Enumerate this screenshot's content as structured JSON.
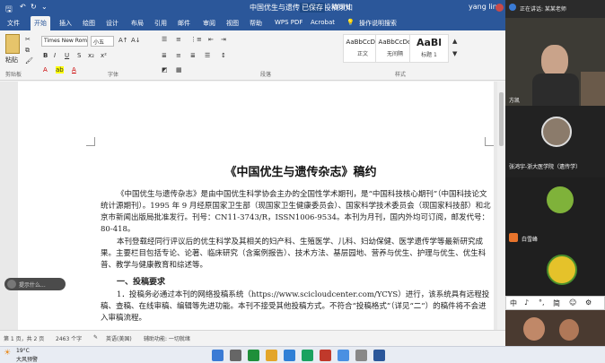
{
  "titlebar": {
    "filename": "中国优生与遗传杂志 -- 投稿须知",
    "badge": "已保存",
    "app": "Word",
    "user": "yang ling"
  },
  "tabs": [
    "文件",
    "开始",
    "插入",
    "绘图",
    "设计",
    "布局",
    "引用",
    "邮件",
    "审阅",
    "视图",
    "帮助",
    "WPS PDF",
    "Acrobat",
    "操作说明搜索"
  ],
  "ribbon": {
    "paste_label": "粘贴",
    "font_name": "Times New Roman",
    "font_size": "小五",
    "styles": [
      {
        "preview": "AaBbCcDd",
        "name": "正文"
      },
      {
        "preview": "AaBbCcDd",
        "name": "无间隔"
      },
      {
        "preview": "AaBl",
        "name": "标题 1"
      }
    ],
    "groups": [
      "剪贴板",
      "字体",
      "段落",
      "样式"
    ]
  },
  "document": {
    "title": "《中国优生与遗传杂志》稿约",
    "para1": "《中国优生与遗传杂志》是由中国优生科学协会主办的全国性学术期刊，是“中国科技核心期刊”（中国科技论文统计源期刊）。1995 年 9 月经原国家卫生部（现国家卫生健康委员会）、国家科学技术委员会（现国家科技部）和北京市新闻出版局批准发行。刊号：CN11-3743/R，ISSN1006-9534。本刊为月刊，国内外均可订阅，邮发代号：80-418。",
    "para2": "本刊登载经同行评议后的优生科学及其相关的妇产科、生殖医学、儿科、妇幼保健、医学遗传学等最新研究成果。主要栏目包括专论、论著、临床研究（含案例报告）、技术方法、基层园地、营养与优生、护理与优生、优生科普、教学与健康教育和综述等。",
    "heading1": "一、投稿要求",
    "para3": "1．投稿务必通过本刊的网络投稿系统（https://www.scicloudcenter.com/YCYS）进行，该系统具有远程投稿、查稿、在线审稿、编辑等先进功能。本刊不接受其他投稿方式。不符合“投稿格式”（详见“二”）的稿件将不会进入审稿流程。"
  },
  "bubble": {
    "text": "提示什么..."
  },
  "statusbar": {
    "page": "第 1 页，共 2 页",
    "words": "2463 个字",
    "lang": "英语(美国)",
    "a11y": "辅助功能: 一切就绪"
  },
  "taskbar": {
    "temp": "19°C",
    "weather": "大风预警"
  },
  "meeting": {
    "participants": [
      {
        "name": "正在讲话: 某某老师"
      },
      {
        "name": "方凯"
      },
      {
        "name": "张鸿宇-浙大医学院（遗传学）"
      },
      {
        "name": ""
      },
      {
        "name": "白雪峰"
      },
      {
        "name": ""
      },
      {
        "name": ""
      }
    ],
    "ime": [
      "中",
      "♪",
      "°,",
      "简",
      "☺",
      "⚙"
    ]
  }
}
